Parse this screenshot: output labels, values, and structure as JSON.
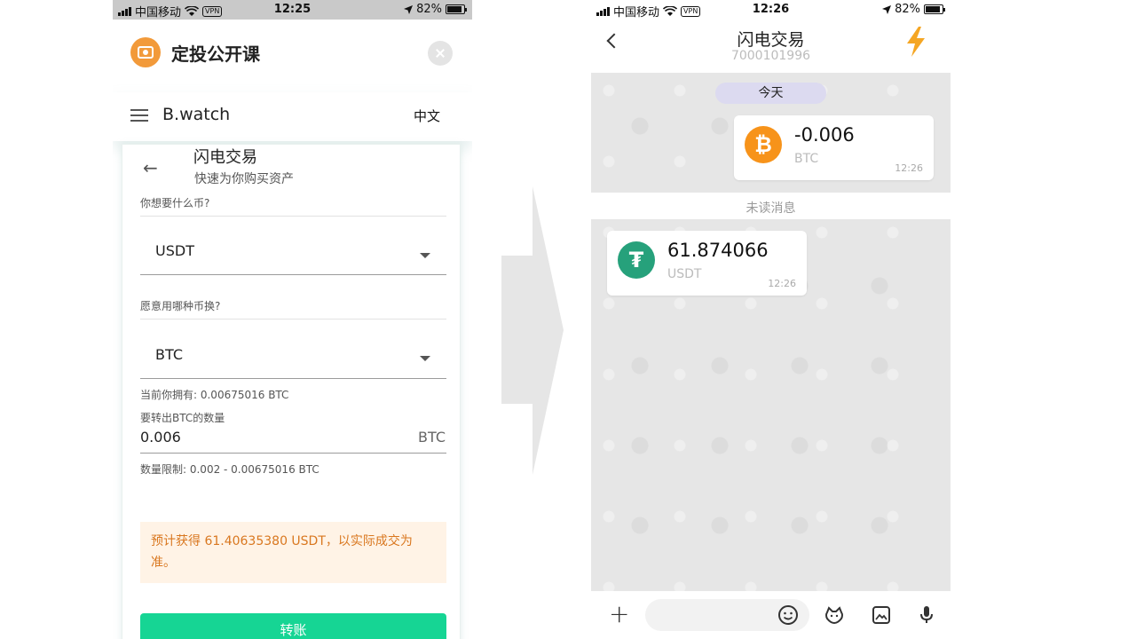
{
  "left_phone": {
    "status": {
      "carrier": "中国移动",
      "vpn": "VPN",
      "time": "12:25",
      "battery": "82%"
    },
    "app_title": "定投公开课",
    "nav": {
      "brand": "B.watch",
      "lang": "中文"
    },
    "form": {
      "title": "闪电交易",
      "subtitle": "快速为你购买资产",
      "want_label": "你想要什么币?",
      "want_value": "USDT",
      "pay_label": "愿意用哪种币换?",
      "pay_value": "BTC",
      "holding": "当前你拥有: 0.00675016 BTC",
      "amount_label": "要转出BTC的数量",
      "amount_value": "0.006",
      "amount_unit": "BTC",
      "limit": "数量限制: 0.002 - 0.00675016 BTC",
      "estimate": "预计获得 61.40635380 USDT，以实际成交为准。",
      "submit": "转账"
    }
  },
  "right_phone": {
    "status": {
      "carrier": "中国移动",
      "vpn": "VPN",
      "time": "12:26",
      "battery": "82%"
    },
    "chat": {
      "title": "闪电交易",
      "id": "7000101996",
      "date_pill": "今天",
      "unread": "未读消息",
      "messages": [
        {
          "value": "-0.006",
          "symbol": "BTC",
          "time": "12:26",
          "icon": "bitcoin-icon",
          "color": "#f7931a"
        },
        {
          "value": "61.874066",
          "symbol": "USDT",
          "time": "12:26",
          "icon": "tether-icon",
          "color": "#26a17b"
        }
      ]
    },
    "input_placeholder": ""
  },
  "colors": {
    "accent_green": "#16d594",
    "warning_text": "#d9771f",
    "bolt": "#f5a623"
  }
}
